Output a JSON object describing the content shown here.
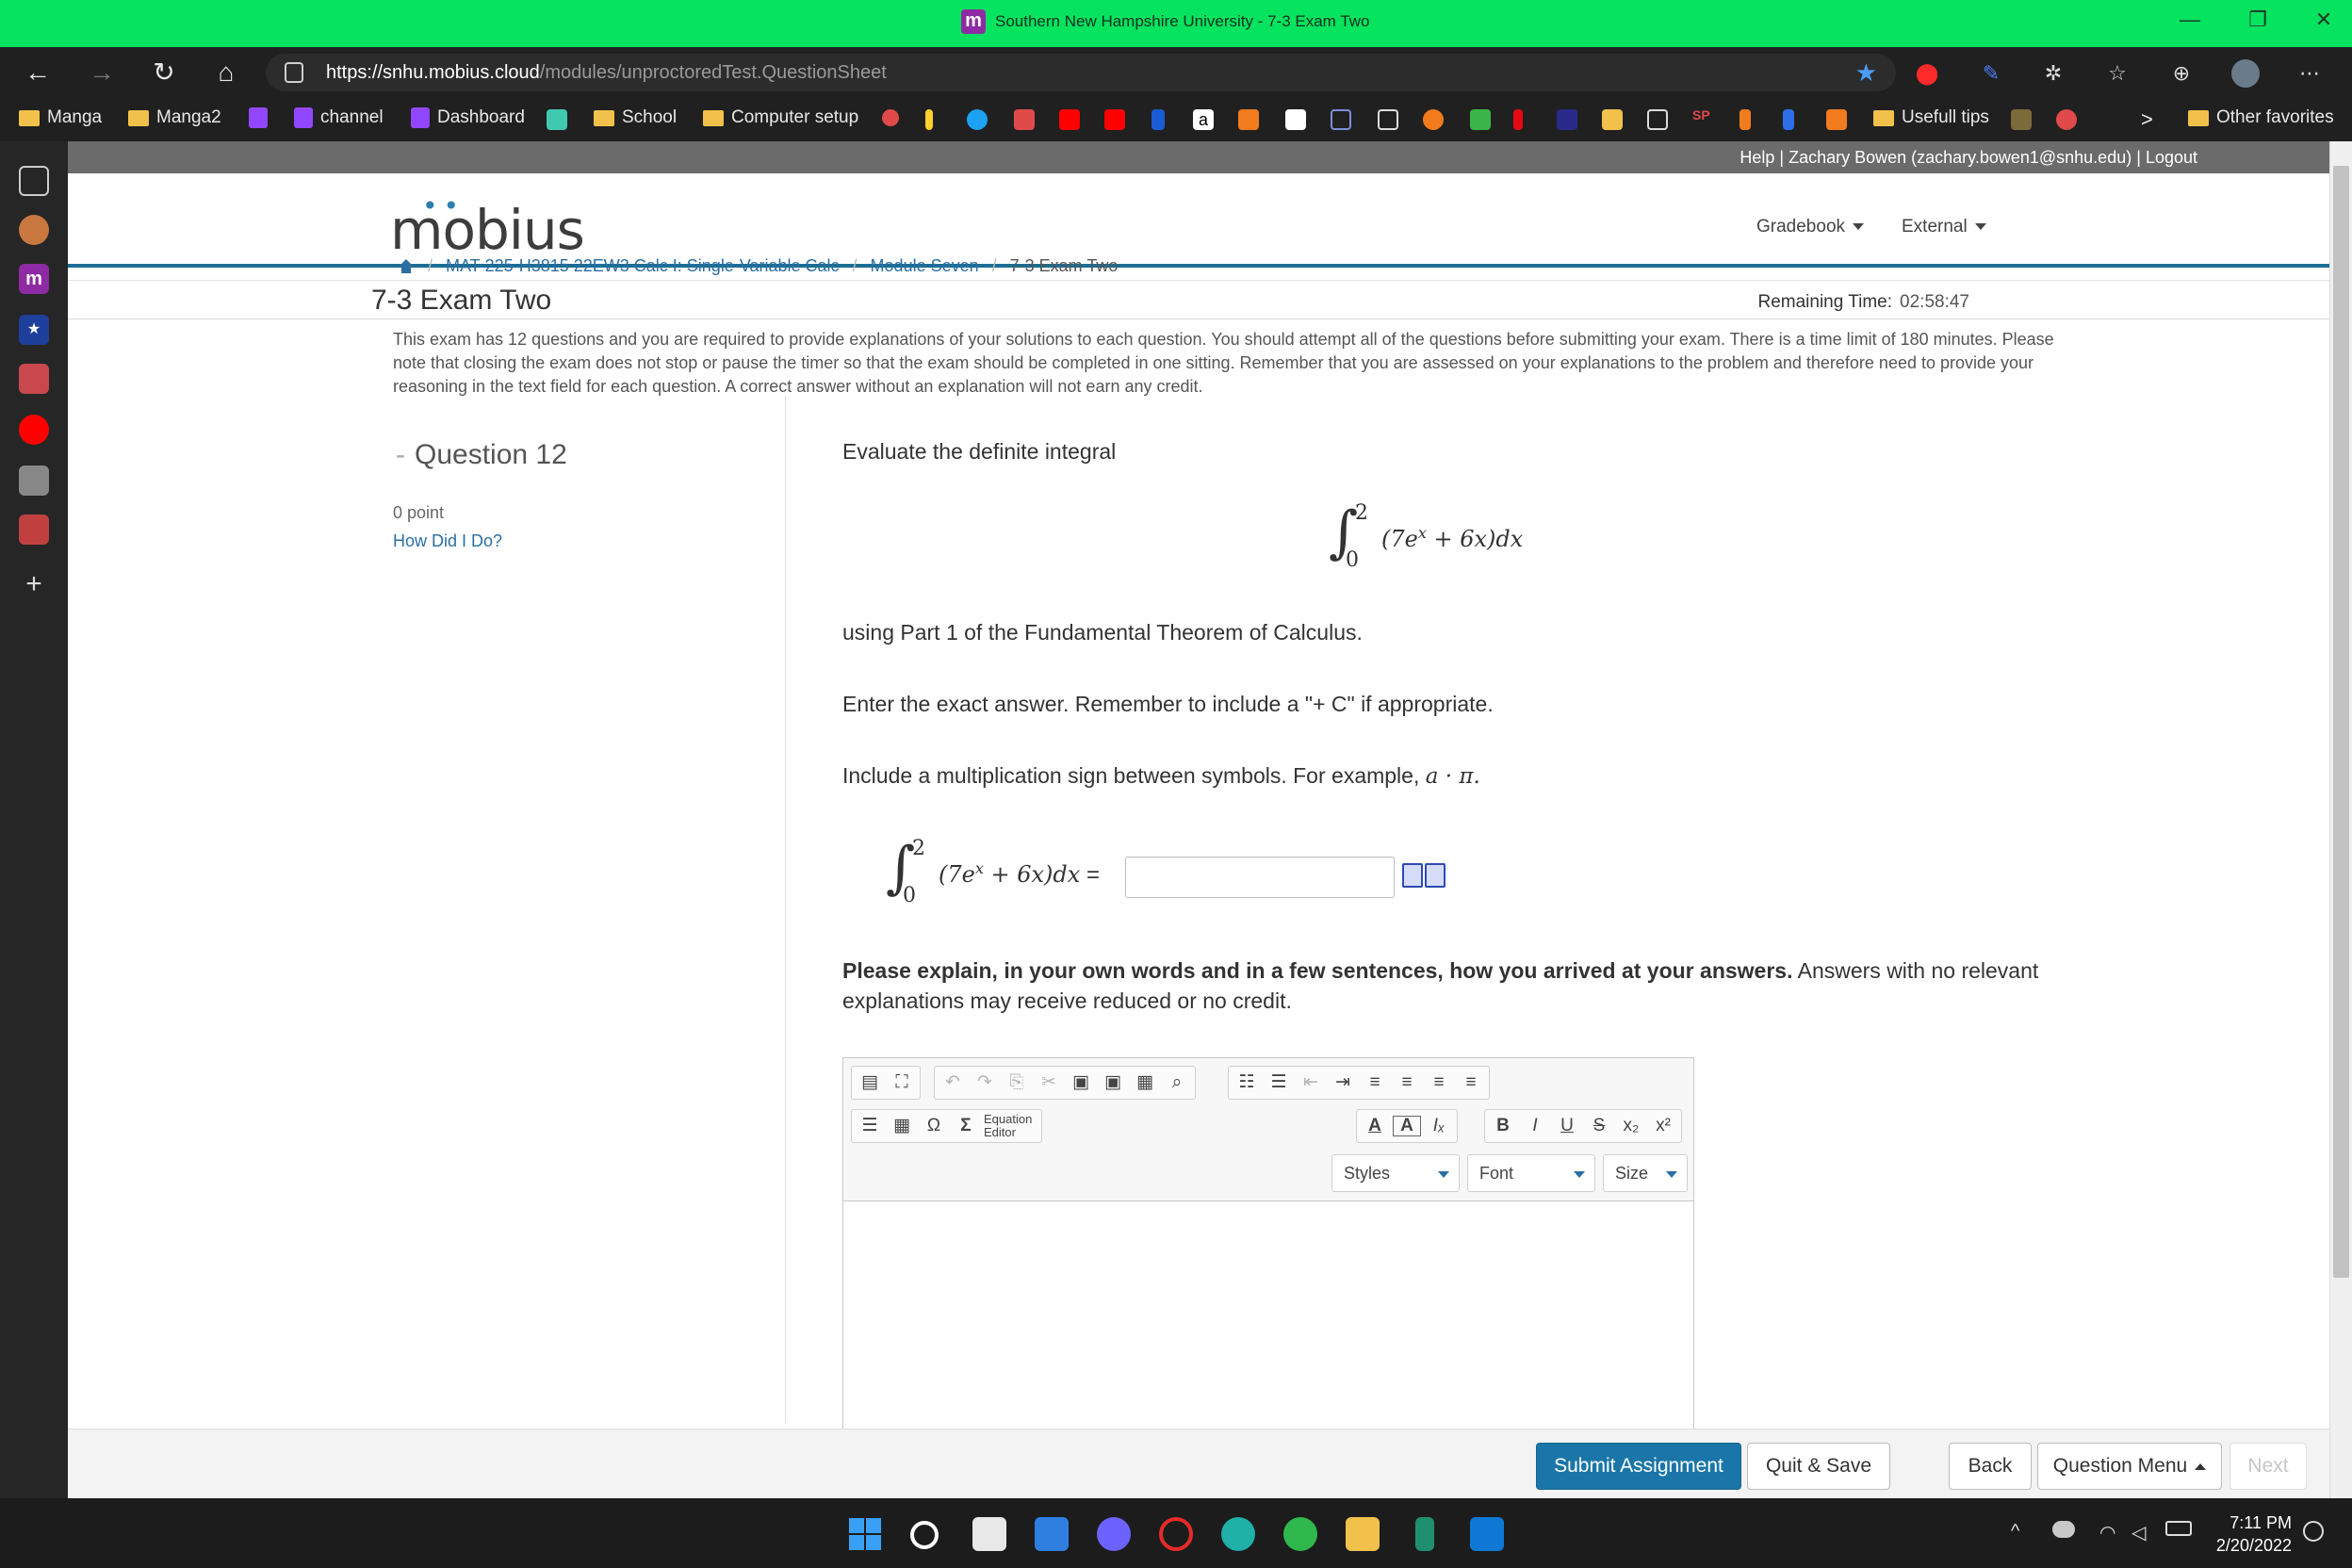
{
  "window": {
    "title": "Southern New Hampshire University - 7-3 Exam Two",
    "favicon_letter": "m",
    "min_glyph": "—",
    "restore_glyph": "❐",
    "close_glyph": "✕"
  },
  "browser": {
    "url_host": "https://snhu.mobius.cloud",
    "url_path": "/modules/unproctoredTest.QuestionSheet",
    "bookmarks": {
      "manga": "Manga",
      "manga2": "Manga2",
      "channel": "channel",
      "dashboard": "Dashboard",
      "school": "School",
      "computer_setup": "Computer setup",
      "usefull_tips": "Usefull tips",
      "other_favorites": "Other favorites",
      "amazon_glyph": "a",
      "sp_glyph": "SP",
      "more_glyph": ">"
    }
  },
  "userbar": {
    "help": "Help",
    "separator": "|",
    "user": "Zachary Bowen (zachary.bowen1@snhu.edu)",
    "logout": "Logout"
  },
  "header": {
    "logo": "mobius",
    "gradebook": "Gradebook",
    "external": "External"
  },
  "breadcrumb": {
    "course": "MAT-225-H3815 22EW3 Calc I: Single-Variable Calc",
    "module": "Module Seven",
    "current": "7-3 Exam Two",
    "sep": "/"
  },
  "exam": {
    "title": "7-3 Exam Two",
    "remaining_label": "Remaining Time:",
    "remaining_value": "02:58:47",
    "instructions": "This exam has 12 questions and you are required to provide explanations of your solutions to each question. You should attempt all of the questions before submitting your exam. There is a time limit of 180 minutes. Please note that closing the exam does not stop or pause the timer so that the exam should be completed in one sitting. Remember that you are assessed on your explanations to the problem and therefore need to provide your reasoning in the text field for each question. A correct answer without an explanation will not earn any credit."
  },
  "question": {
    "dash": "-",
    "title": "Question 12",
    "points": "0 point",
    "how_did_i_do": "How Did I Do?",
    "prompt": "Evaluate the definite integral",
    "part1": "using Part 1 of the Fundamental Theorem of Calculus.",
    "exact": "Enter the exact answer. Remember to include a \"+ C\" if appropriate.",
    "mult_sign": "Include a multiplication sign between symbols. For example,",
    "example_math": "a · π.",
    "integral": {
      "sign": "∫",
      "upper": "2",
      "lower": "0",
      "integrand": "(7e",
      "exponent": "x",
      "rest": " + 6x)dx",
      "equals": "="
    },
    "explain_bold": "Please explain, in your own words and in a few sentences, how you arrived at your answers.",
    "explain_rest": " Answers with no relevant explanations may receive reduced or no credit."
  },
  "editor": {
    "equation_label_1": "Equation",
    "equation_label_2": "Editor",
    "styles": "Styles",
    "font": "Font",
    "size": "Size",
    "glyphs": {
      "source": "▤",
      "maximize": "⛶",
      "undo": "↶",
      "redo": "↷",
      "copy": "⎘",
      "cut": "✂",
      "paste": "📋",
      "paste_text": "▣",
      "paste_word": "▦",
      "find": "🔍",
      "numbered": "☷",
      "bullets": "☰",
      "outdent": "⇤",
      "indent": "⇥",
      "align_left": "≡",
      "align_center": "≡",
      "align_right": "≡",
      "justify": "≡",
      "hr": "☰",
      "table": "▦",
      "omega": "Ω",
      "sigma": "Σ",
      "text_color": "A",
      "bg_color": "A",
      "clear_format": "Iₓ",
      "bold": "B",
      "italic": "I",
      "underline": "U",
      "strike": "S",
      "sub": "x₂",
      "sup": "x²",
      "dropdown_arrow": "▾"
    }
  },
  "bottom": {
    "submit": "Submit Assignment",
    "quit": "Quit & Save",
    "back": "Back",
    "question_menu": "Question Menu",
    "next": "Next"
  },
  "taskbar": {
    "time": "7:11 PM",
    "date": "2/20/2022",
    "chevron_up": "^"
  },
  "colors": {
    "titlebar": "#05e35f",
    "accent": "#1a76a8",
    "link": "#2b6ea3",
    "header_rule": "#1a6e94"
  }
}
